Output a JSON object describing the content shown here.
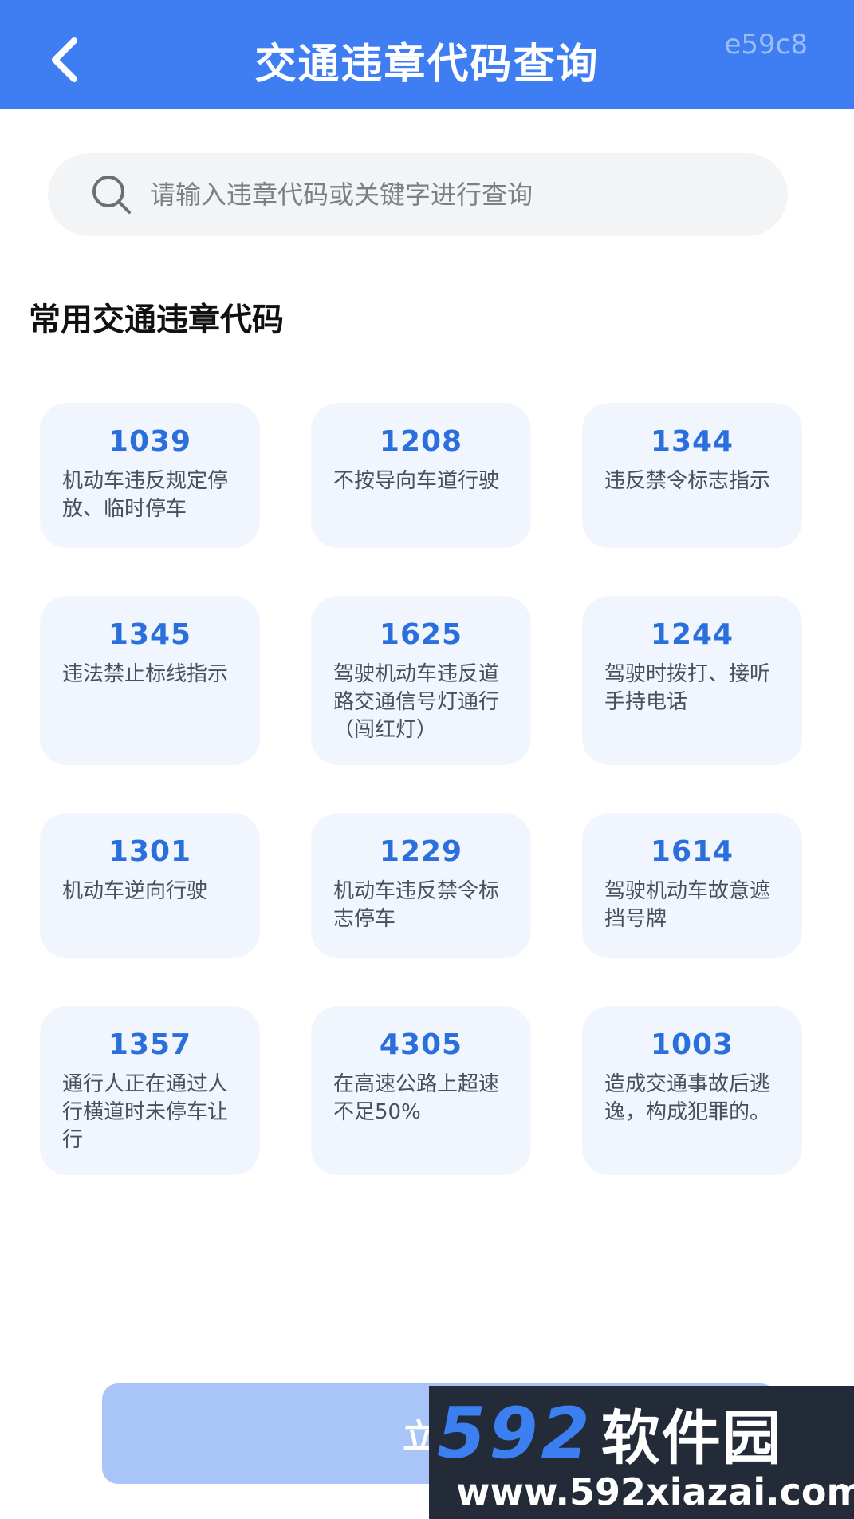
{
  "header": {
    "title": "交通违章代码查询",
    "code": "e59c8",
    "back_icon": "back-chevron-icon",
    "background": "#3f7df2"
  },
  "search": {
    "placeholder": "请输入违章代码或关键字进行查询",
    "value": "",
    "icon": "search-icon"
  },
  "section": {
    "title": "常用交通违章代码"
  },
  "cards": [
    {
      "code": "1039",
      "desc": "机动车违反规定停放、临时停车"
    },
    {
      "code": "1208",
      "desc": "不按导向车道行驶"
    },
    {
      "code": "1344",
      "desc": "违反禁令标志指示"
    },
    {
      "code": "1345",
      "desc": "违法禁止标线指示"
    },
    {
      "code": "1625",
      "desc": "驾驶机动车违反道路交通信号灯通行（闯红灯）"
    },
    {
      "code": "1244",
      "desc": "驾驶时拨打、接听手持电话"
    },
    {
      "code": "1301",
      "desc": "机动车逆向行驶"
    },
    {
      "code": "1229",
      "desc": "机动车违反禁令标志停车"
    },
    {
      "code": "1614",
      "desc": "驾驶机动车故意遮挡号牌"
    },
    {
      "code": "1357",
      "desc": "通行人正在通过人行横道时未停车让行"
    },
    {
      "code": "4305",
      "desc": "在高速公路上超速不足50%"
    },
    {
      "code": "1003",
      "desc": "造成交通事故后逃逸，构成犯罪的。"
    }
  ],
  "bottom_button": {
    "label": "立即"
  },
  "watermark": {
    "number": "592",
    "name": "软件园",
    "url": "www.592xiazai.com"
  },
  "colors": {
    "accent": "#3f7df2",
    "card_bg": "#f1f6fe",
    "code_text": "#2b6fdc",
    "button_bg": "#a9c4f7"
  }
}
